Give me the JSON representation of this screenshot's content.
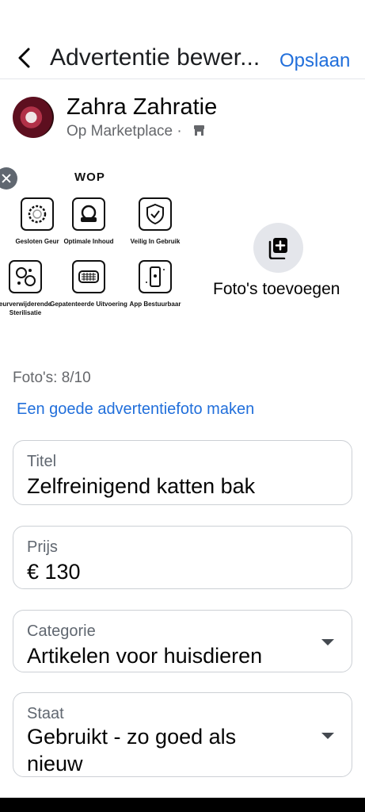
{
  "header": {
    "title": "Advertentie bewer...",
    "save_label": "Opslaan",
    "back_icon": "chevron-left-icon"
  },
  "profile": {
    "name": "Zahra Zahratie",
    "location": "Op Marketplace ·"
  },
  "photo": {
    "brand": "WOP",
    "features": [
      {
        "label": "Gesloten Geur",
        "icon": "odor-seal-icon"
      },
      {
        "label": "Optimale Inhoud",
        "icon": "bin-capacity-icon"
      },
      {
        "label": "Veilig In Gebruik",
        "icon": "shield-check-icon"
      },
      {
        "label": "eurverwijderende Sterilisatie",
        "icon": "sterilization-icon"
      },
      {
        "label": "Gepatenteerde Uitvoering",
        "icon": "patent-mesh-icon"
      },
      {
        "label": "App Bestuurbaar",
        "icon": "phone-app-icon"
      }
    ]
  },
  "add_photos_label": "Foto's toevoegen",
  "photo_count": "Foto's: 8/10",
  "photo_tip_link": "Een goede advertentiefoto maken",
  "fields": {
    "title": {
      "label": "Titel",
      "value": "Zelfreinigend katten bak"
    },
    "price": {
      "label": "Prijs",
      "value": "€ 130"
    },
    "category": {
      "label": "Categorie",
      "value": "Artikelen voor huisdieren"
    },
    "condition": {
      "label": "Staat",
      "value_line1": "Gebruikt - zo goed als",
      "value_line2": "nieuw"
    }
  },
  "colors": {
    "link": "#216fdb",
    "secondary_text": "#65676b",
    "border": "#ccd0d5"
  }
}
